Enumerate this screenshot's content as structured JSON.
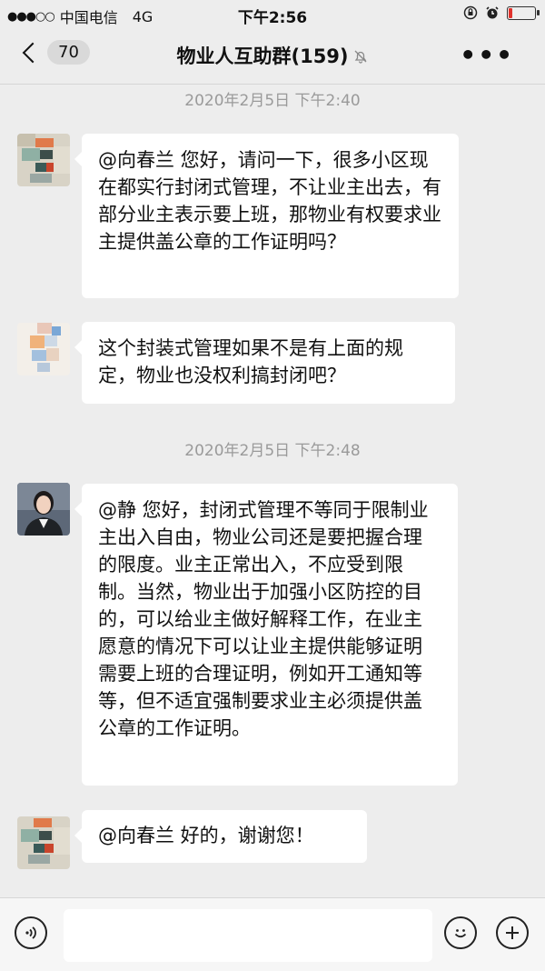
{
  "status_bar": {
    "signal": "●●●○○",
    "carrier": "中国电信",
    "network": "4G",
    "time": "下午2:56",
    "battery_level": 0.12
  },
  "nav": {
    "unread_count": "70",
    "title": "物业人互助群(159)",
    "more_label": "•••"
  },
  "messages": [
    {
      "timestamp": "2020年2月5日 下午2:40"
    },
    {
      "text": "@向春兰 您好，请问一下，很多小区现在都实行封闭式管理，不让业主出去，有部分业主表示要上班，那物业有权要求业主提供盖公章的工作证明吗？"
    },
    {
      "text": "这个封装式管理如果不是有上面的规定，物业也没权利搞封闭吧？"
    },
    {
      "timestamp": "2020年2月5日 下午2:48"
    },
    {
      "text": "@静 您好，封闭式管理不等同于限制业主出入自由，物业公司还是要把握合理的限度。业主正常出入，不应受到限制。当然，物业出于加强小区防控的目的，可以给业主做好解释工作，在业主愿意的情况下可以让业主提供能够证明需要上班的合理证明，例如开工通知等等，但不适宜强制要求业主必须提供盖公章的工作证明。"
    },
    {
      "text": "@向春兰 好的，谢谢您！"
    }
  ],
  "input": {
    "value": ""
  }
}
